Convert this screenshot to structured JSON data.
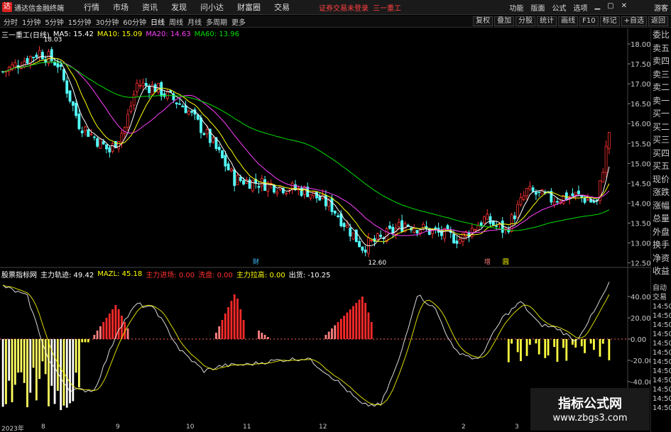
{
  "topbar": {
    "app_title": "通达信金融终端",
    "menu": [
      "行情",
      "市场",
      "资讯",
      "发现",
      "问小达",
      "财富圈",
      "交易"
    ],
    "login_status": "证券交易未登录",
    "stock_name": "三一重工",
    "right_menu": [
      "功能",
      "版面",
      "公式",
      "选项"
    ],
    "guest": "游客"
  },
  "toolbar": {
    "periods": [
      "分时",
      "1分钟",
      "5分钟",
      "15分钟",
      "30分钟",
      "60分钟",
      "日线",
      "周线",
      "月线",
      "多周期",
      "更多"
    ],
    "active_period": "日线",
    "functions": [
      "复权",
      "叠加",
      "分股",
      "统计",
      "画线",
      "F10",
      "标记",
      "+自选",
      "返回"
    ]
  },
  "main": {
    "title": "三一重工(日线)",
    "ma5": "MA5: 15.42",
    "ma10": "MA10: 15.09",
    "ma20": "MA20: 14.63",
    "ma60": "MA60: 13.96",
    "high_label": "18.03",
    "low_label": "12.60",
    "events": [
      "财",
      "增",
      "圆"
    ]
  },
  "indicator": {
    "name": "股票指标网",
    "fields": [
      {
        "t": "主力轨迹: 49.42",
        "c": "#ffffff"
      },
      {
        "t": "MAZL: 45.18",
        "c": "#ffff00"
      },
      {
        "t": "主力进场: 0.00",
        "c": "#ff3030"
      },
      {
        "t": "洗盘: 0.00",
        "c": "#ff3030"
      },
      {
        "t": "主力拉高: 0.00",
        "c": "#ffff00"
      },
      {
        "t": "出货: -10.25",
        "c": "#ffffff"
      }
    ]
  },
  "price_axis": [
    "18.00",
    "17.50",
    "17.00",
    "16.50",
    "16.00",
    "15.50",
    "15.00",
    "14.50",
    "14.00",
    "13.50",
    "13.00",
    "12.50"
  ],
  "ind_axis": [
    "40.00",
    "20.00",
    "0.00",
    "-20.00",
    "-40.00"
  ],
  "right_panel": {
    "quote": [
      "委比",
      "卖五",
      "卖四",
      "卖三",
      "卖二",
      "卖一",
      "买一",
      "买二",
      "买三",
      "买四",
      "买五",
      "现价",
      "涨跌",
      "涨幅",
      "总量",
      "外盘",
      "换手",
      "净资",
      "收益"
    ],
    "bottom": [
      "自动",
      "交易",
      "14:50",
      "14:50",
      "14:50",
      "14:50",
      "14:50",
      "14:50",
      "14:50",
      "14:50",
      "14:50",
      "14:50",
      "14:50",
      "14:50"
    ]
  },
  "dates": [
    "2023年",
    "8",
    "9",
    "10",
    "11",
    "12",
    "2",
    "3"
  ],
  "watermark": {
    "line1": "指标公式网",
    "line2": "www.zbgs3.com"
  },
  "colors": {
    "up": "#ff3232",
    "down": "#54ffff",
    "ma5": "#ffffff",
    "ma10": "#ffff00",
    "ma20": "#ff40ff",
    "ma60": "#00e000",
    "zl": "#ffffff",
    "mazl": "#ffff00"
  }
}
